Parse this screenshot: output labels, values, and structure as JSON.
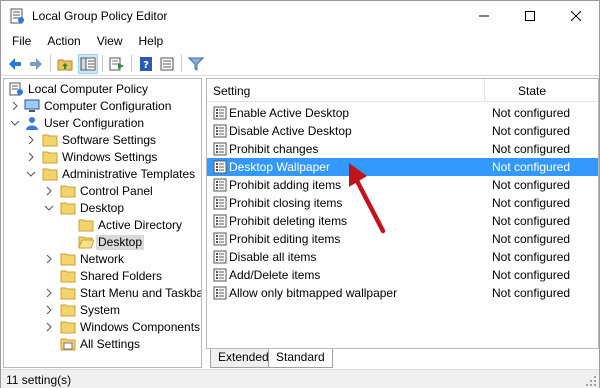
{
  "window": {
    "title": "Local Group Policy Editor",
    "accent": "#3399ff"
  },
  "menu": {
    "file": "File",
    "action": "Action",
    "view": "View",
    "help": "Help"
  },
  "toolbar": {
    "icons": [
      "back-icon",
      "forward-icon",
      "up-folder-icon",
      "show-hide-tree-icon",
      "export-list-icon",
      "help-icon",
      "properties-icon",
      "filter-icon"
    ]
  },
  "tree": {
    "root": "Local Computer Policy",
    "items": [
      {
        "label": "Computer Configuration"
      },
      {
        "label": "User Configuration"
      },
      {
        "label": "Software Settings"
      },
      {
        "label": "Windows Settings"
      },
      {
        "label": "Administrative Templates"
      },
      {
        "label": "Control Panel"
      },
      {
        "label": "Desktop"
      },
      {
        "label": "Active Directory"
      },
      {
        "label": "Desktop"
      },
      {
        "label": "Network"
      },
      {
        "label": "Shared Folders"
      },
      {
        "label": "Start Menu and Taskbar"
      },
      {
        "label": "System"
      },
      {
        "label": "Windows Components"
      },
      {
        "label": "All Settings"
      }
    ]
  },
  "list": {
    "col_setting": "Setting",
    "col_state": "State",
    "rows": [
      {
        "name": "Enable Active Desktop",
        "state": "Not configured"
      },
      {
        "name": "Disable Active Desktop",
        "state": "Not configured"
      },
      {
        "name": "Prohibit changes",
        "state": "Not configured"
      },
      {
        "name": "Desktop Wallpaper",
        "state": "Not configured"
      },
      {
        "name": "Prohibit adding items",
        "state": "Not configured"
      },
      {
        "name": "Prohibit closing items",
        "state": "Not configured"
      },
      {
        "name": "Prohibit deleting items",
        "state": "Not configured"
      },
      {
        "name": "Prohibit editing items",
        "state": "Not configured"
      },
      {
        "name": "Disable all items",
        "state": "Not configured"
      },
      {
        "name": "Add/Delete items",
        "state": "Not configured"
      },
      {
        "name": "Allow only bitmapped wallpaper",
        "state": "Not configured"
      }
    ]
  },
  "tabs": {
    "extended": "Extended",
    "standard": "Standard"
  },
  "status": {
    "text": "11 setting(s)"
  },
  "annotation": {
    "arrow_color": "#c0141c"
  }
}
